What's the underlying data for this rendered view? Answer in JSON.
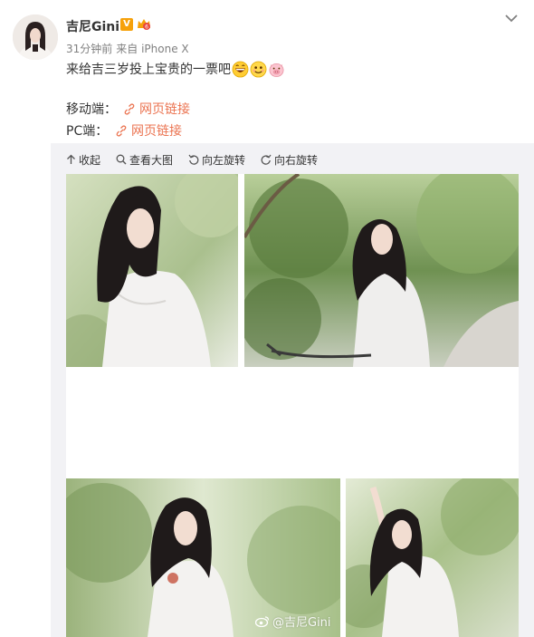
{
  "user": {
    "name": "吉尼Gini",
    "verified_badge": "V",
    "time": "31分钟前",
    "source": "来自 iPhone X"
  },
  "post": {
    "text": "来给吉三岁投上宝贵的一票吧",
    "emojis": [
      "grinning-face-icon",
      "smiling-face-icon",
      "pig-face-icon"
    ]
  },
  "links": [
    {
      "label": "移动端：",
      "link_text": "网页链接"
    },
    {
      "label": "PC端：",
      "link_text": "网页链接"
    }
  ],
  "toolbar": {
    "collapse": "收起",
    "view_large": "查看大图",
    "rotate_left": "向左旋转",
    "rotate_right": "向右旋转"
  },
  "photos": [
    {
      "name": "photo-girl-closeup-left"
    },
    {
      "name": "photo-girl-with-bicycle"
    },
    {
      "name": "photo-girl-portrait-trees"
    },
    {
      "name": "photo-girl-arm-raised"
    }
  ],
  "watermark": "@吉尼Gini",
  "colors": {
    "link": "#eb7350",
    "panel_bg": "#f2f2f5",
    "badge": "#f6a10a",
    "meta": "#808080"
  }
}
